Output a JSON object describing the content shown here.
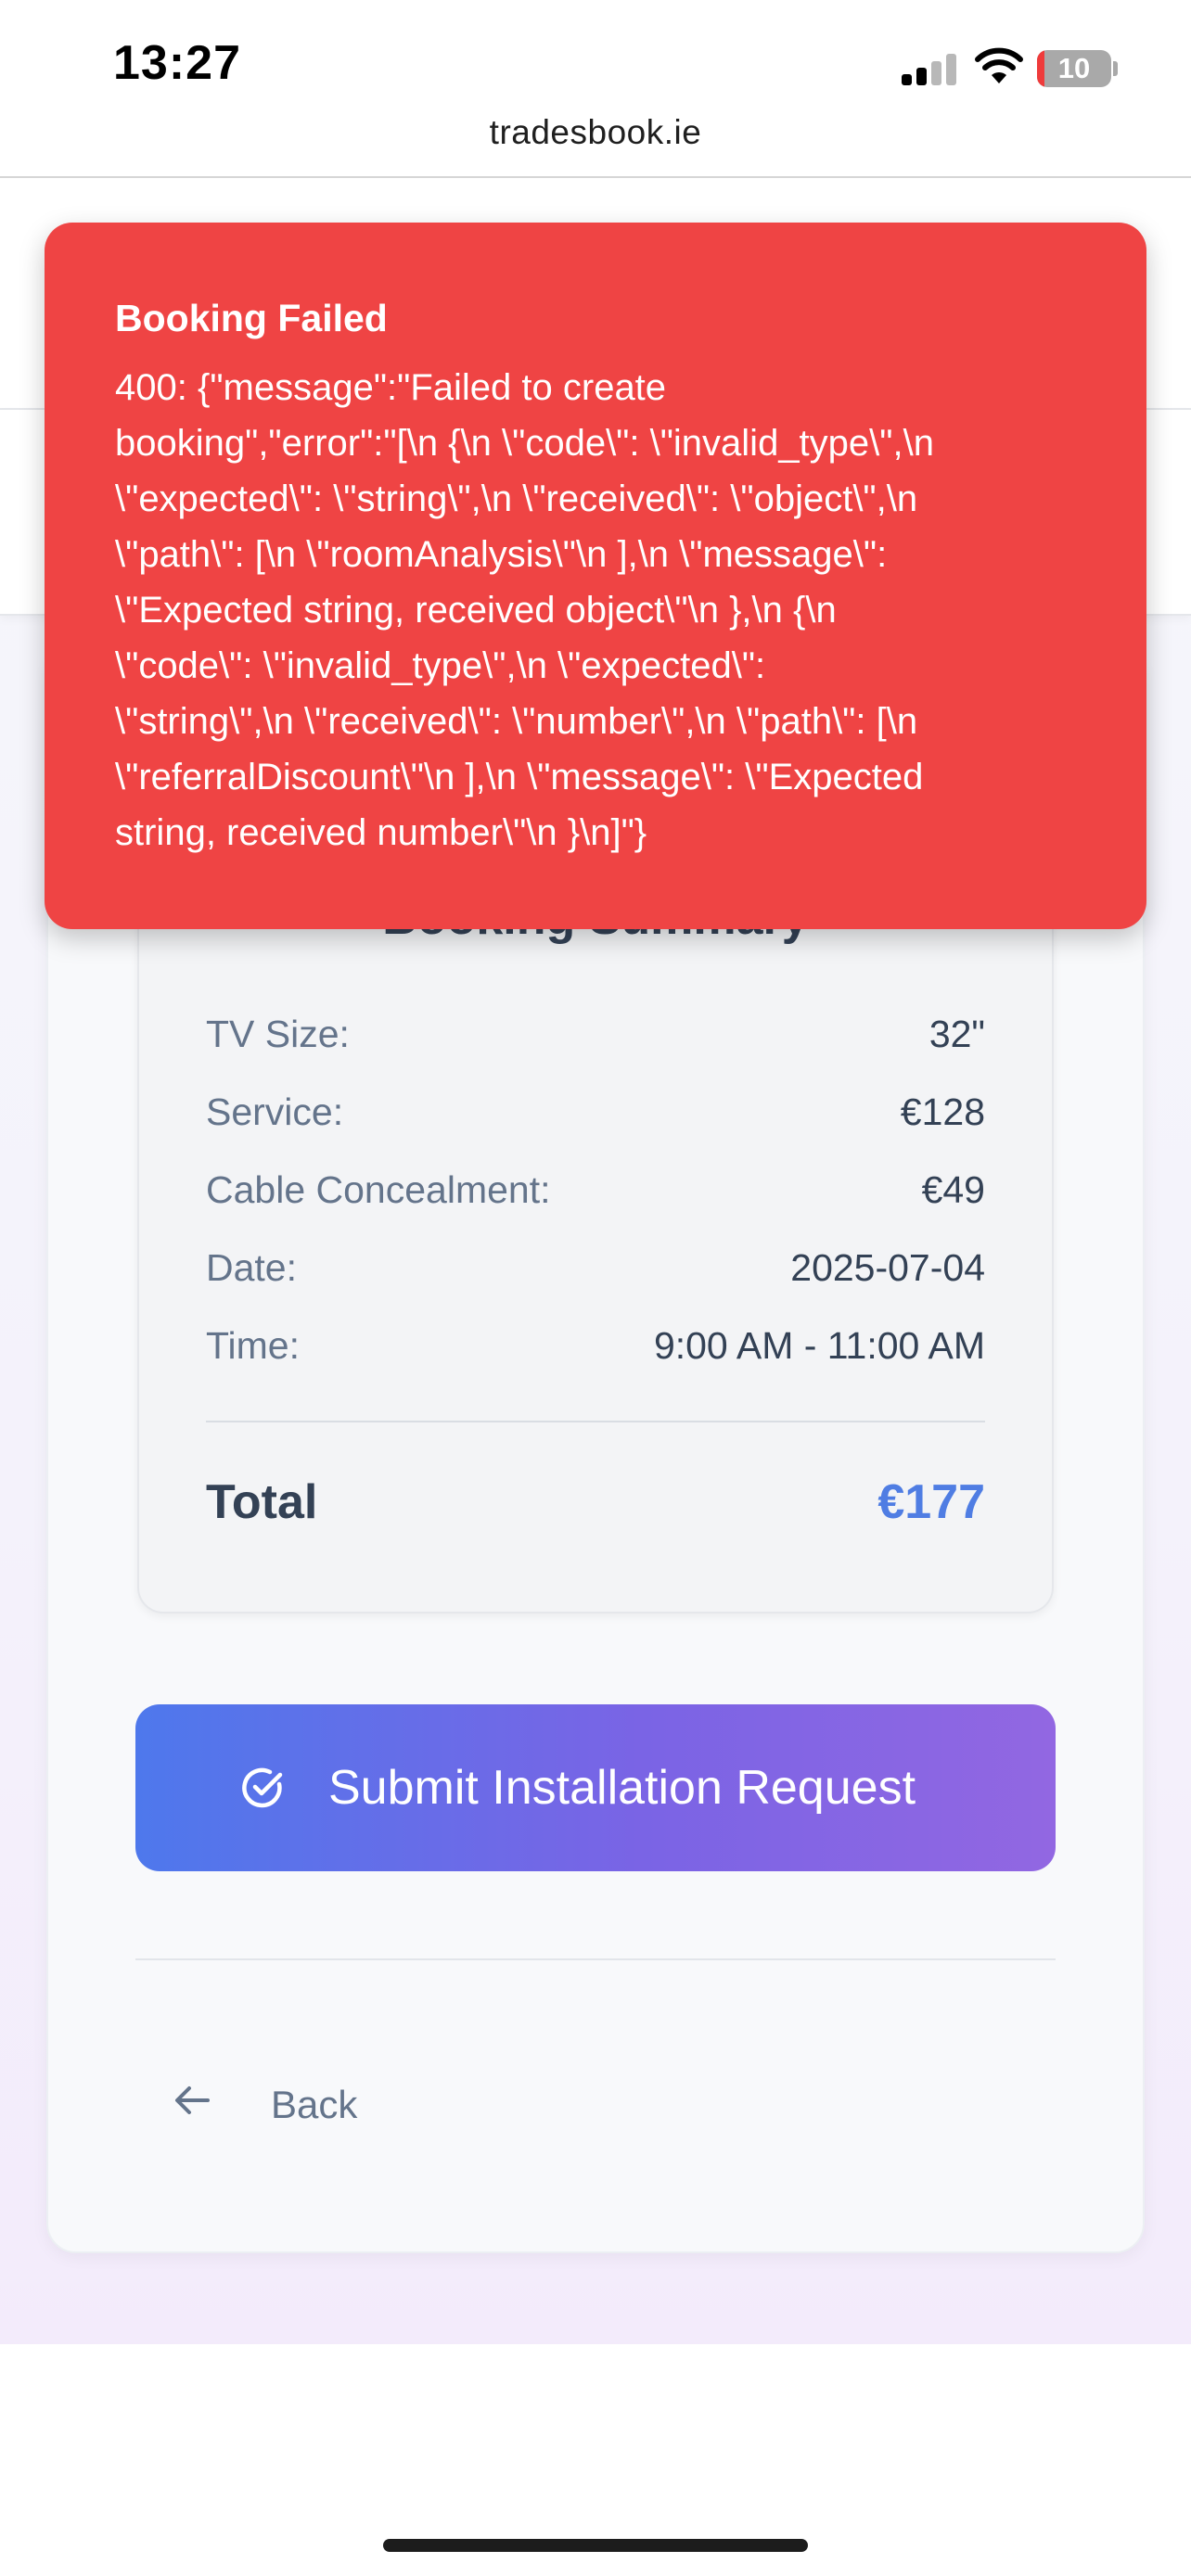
{
  "status_bar": {
    "time": "13:27",
    "battery_level": "10",
    "icons": [
      "signal-icon",
      "wifi-icon",
      "battery-icon"
    ]
  },
  "browser": {
    "url": "tradesbook.ie"
  },
  "toast": {
    "title": "Booking Failed",
    "message_lines": [
      "400: {\"message\":\"Failed to create",
      "booking\",\"error\":\"[\\n {\\n \\\"code\\\": \\\"invalid_type\\\",\\n",
      "\\\"expected\\\": \\\"string\\\",\\n \\\"received\\\": \\\"object\\\",\\n",
      "\\\"path\\\": [\\n \\\"roomAnalysis\\\"\\n ],\\n \\\"message\\\":",
      "\\\"Expected string, received object\\\"\\n },\\n {\\n",
      "\\\"code\\\": \\\"invalid_type\\\",\\n \\\"expected\\\":",
      "\\\"string\\\",\\n \\\"received\\\": \\\"number\\\",\\n \\\"path\\\": [\\n",
      "\\\"referralDiscount\\\"\\n ],\\n \\\"message\\\": \\\"Expected",
      "string, received number\\\"\\n }\\n]\"}"
    ],
    "color": "#ef4444"
  },
  "summary": {
    "title": "Booking Summary",
    "rows": [
      {
        "label": "TV Size:",
        "value": "32\""
      },
      {
        "label": "Service:",
        "value": "€128"
      },
      {
        "label": "Cable Concealment:",
        "value": "€49"
      },
      {
        "label": "Date:",
        "value": "2025-07-04"
      },
      {
        "label": "Time:",
        "value": "9:00 AM - 11:00 AM"
      }
    ],
    "total_label": "Total",
    "total_value": "€177",
    "accent_color": "#4f7de3"
  },
  "actions": {
    "submit_label": "Submit Installation Request",
    "submit_icon": "check-circle-icon",
    "back_label": "Back",
    "back_icon": "arrow-left-icon"
  }
}
